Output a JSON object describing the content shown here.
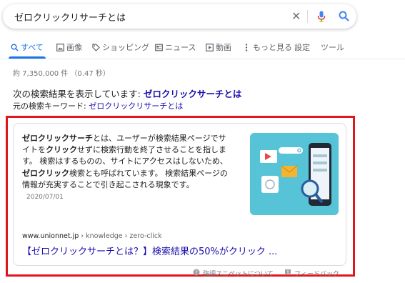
{
  "search": {
    "query": "ゼロクリックリサーチとは"
  },
  "tabs": [
    {
      "label": "すべて",
      "icon": "search-icon"
    },
    {
      "label": "画像",
      "icon": "image-icon"
    },
    {
      "label": "ショッピング",
      "icon": "tag-icon"
    },
    {
      "label": "ニュース",
      "icon": "news-icon"
    },
    {
      "label": "動画",
      "icon": "video-icon"
    },
    {
      "label": "もっと見る",
      "icon": "more-vert-icon"
    },
    {
      "label": "設定"
    },
    {
      "label": "ツール"
    }
  ],
  "stats": "約 7,350,000 件 （0.47 秒）",
  "correction": {
    "showing_prefix": "次の検索結果を表示しています: ",
    "showing_link": "ゼロクリックサーチとは",
    "original_prefix": "元の検索キーワード: ",
    "original_link": "ゼロクリックリサーチとは"
  },
  "snippet": {
    "parts": {
      "t1": "ゼロクリックサーチ",
      "t2": "とは、ユーザーが検索結果ページでサイトを",
      "t3": "クリック",
      "t4": "せずに検索行動を終了させることを指します。 検索はするものの、サイトにアクセスはしないため、",
      "t5": "ゼロクリック",
      "t6": "検索とも呼ばれています。 検索結果ページの情報が充実することで引き起こされる現象です。"
    },
    "date": "2020/07/01",
    "site": "www.unionnet.jp",
    "path": " › knowledge › zero-click",
    "title": "【ゼロクリックサーチとは？】検索結果の50%がクリック ..."
  },
  "footer": {
    "about": "強調スニペットについて",
    "feedback": "フィードバック"
  },
  "colors": {
    "link": "#1a0dab",
    "accent": "#1a73e8",
    "highlight_border": "#e0161c"
  }
}
